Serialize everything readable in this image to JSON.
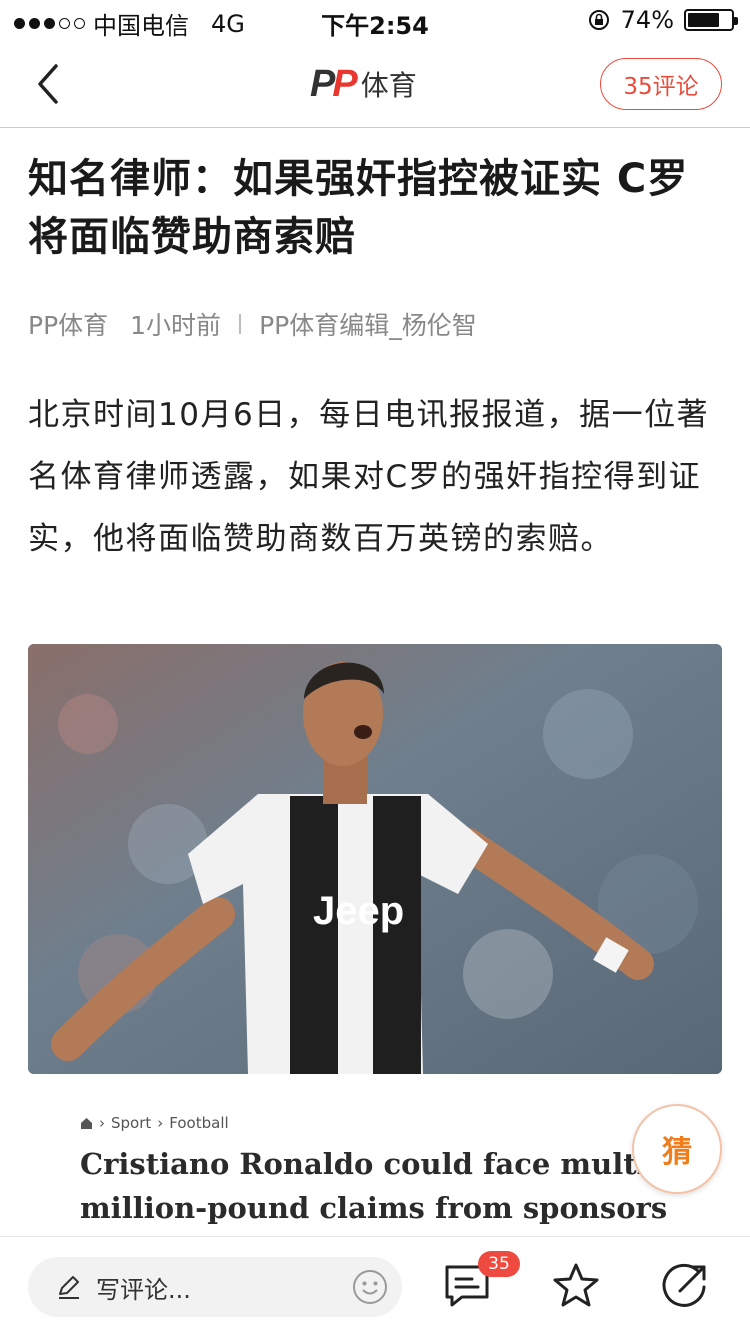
{
  "status_bar": {
    "carrier": "中国电信",
    "network": "4G",
    "time": "下午2:54",
    "battery": "74%",
    "battery_level": 0.74
  },
  "nav": {
    "logo_text": "体育",
    "comments_button": "35评论"
  },
  "article": {
    "title": "知名律师：如果强奸指控被证实 C罗将面临赞助商索赔",
    "source": "PP体育",
    "time_ago": "1小时前",
    "editor": "PP体育编辑_杨伦智",
    "paragraph": "北京时间10月6日，每日电讯报报道，据一位著名体育律师透露，如果对C罗的强奸指控得到证实，他将面临赞助商数百万英镑的索赔。",
    "photo_jersey_text": "Jeep"
  },
  "embedded": {
    "crumb_1": "Sport",
    "crumb_2": "Football",
    "headline": "Cristiano Ronaldo could face multi-million-pound claims from sponsors if"
  },
  "guess_button": "猜",
  "bottom_bar": {
    "comment_placeholder": "写评论...",
    "comment_count": "35"
  },
  "colors": {
    "accent": "#e84c3d",
    "guess": "#ef7d1c"
  }
}
